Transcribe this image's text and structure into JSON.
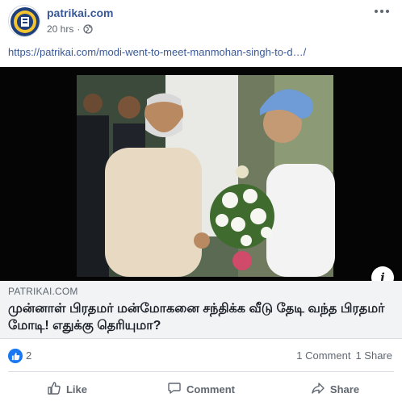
{
  "post": {
    "page_name": "patrikai.com",
    "timestamp": "20 hrs",
    "separator": "·",
    "link_text": "https://patrikai.com/modi-went-to-meet-manmohan-singh-to-d…/"
  },
  "preview": {
    "domain": "PATRIKAI.COM",
    "title": "முன்னாள் பிரதமர் மன்மோகனை சந்திக்க வீடு தேடி வந்த பிரதமர் மோடி! எதுக்கு தெரியுமா?",
    "info_icon": "i"
  },
  "stats": {
    "likes": "2",
    "comments": "1 Comment",
    "shares": "1 Share"
  },
  "actions": {
    "like": "Like",
    "comment": "Comment",
    "share": "Share"
  },
  "colors": {
    "link": "#385898",
    "like_blue": "#1877f2",
    "muted": "#606770",
    "caption_bg": "#f2f3f5"
  },
  "icons": [
    "globe-icon",
    "more-options-icon",
    "info-icon",
    "like-reaction-icon",
    "thumbs-up-icon",
    "comment-icon",
    "share-icon"
  ]
}
